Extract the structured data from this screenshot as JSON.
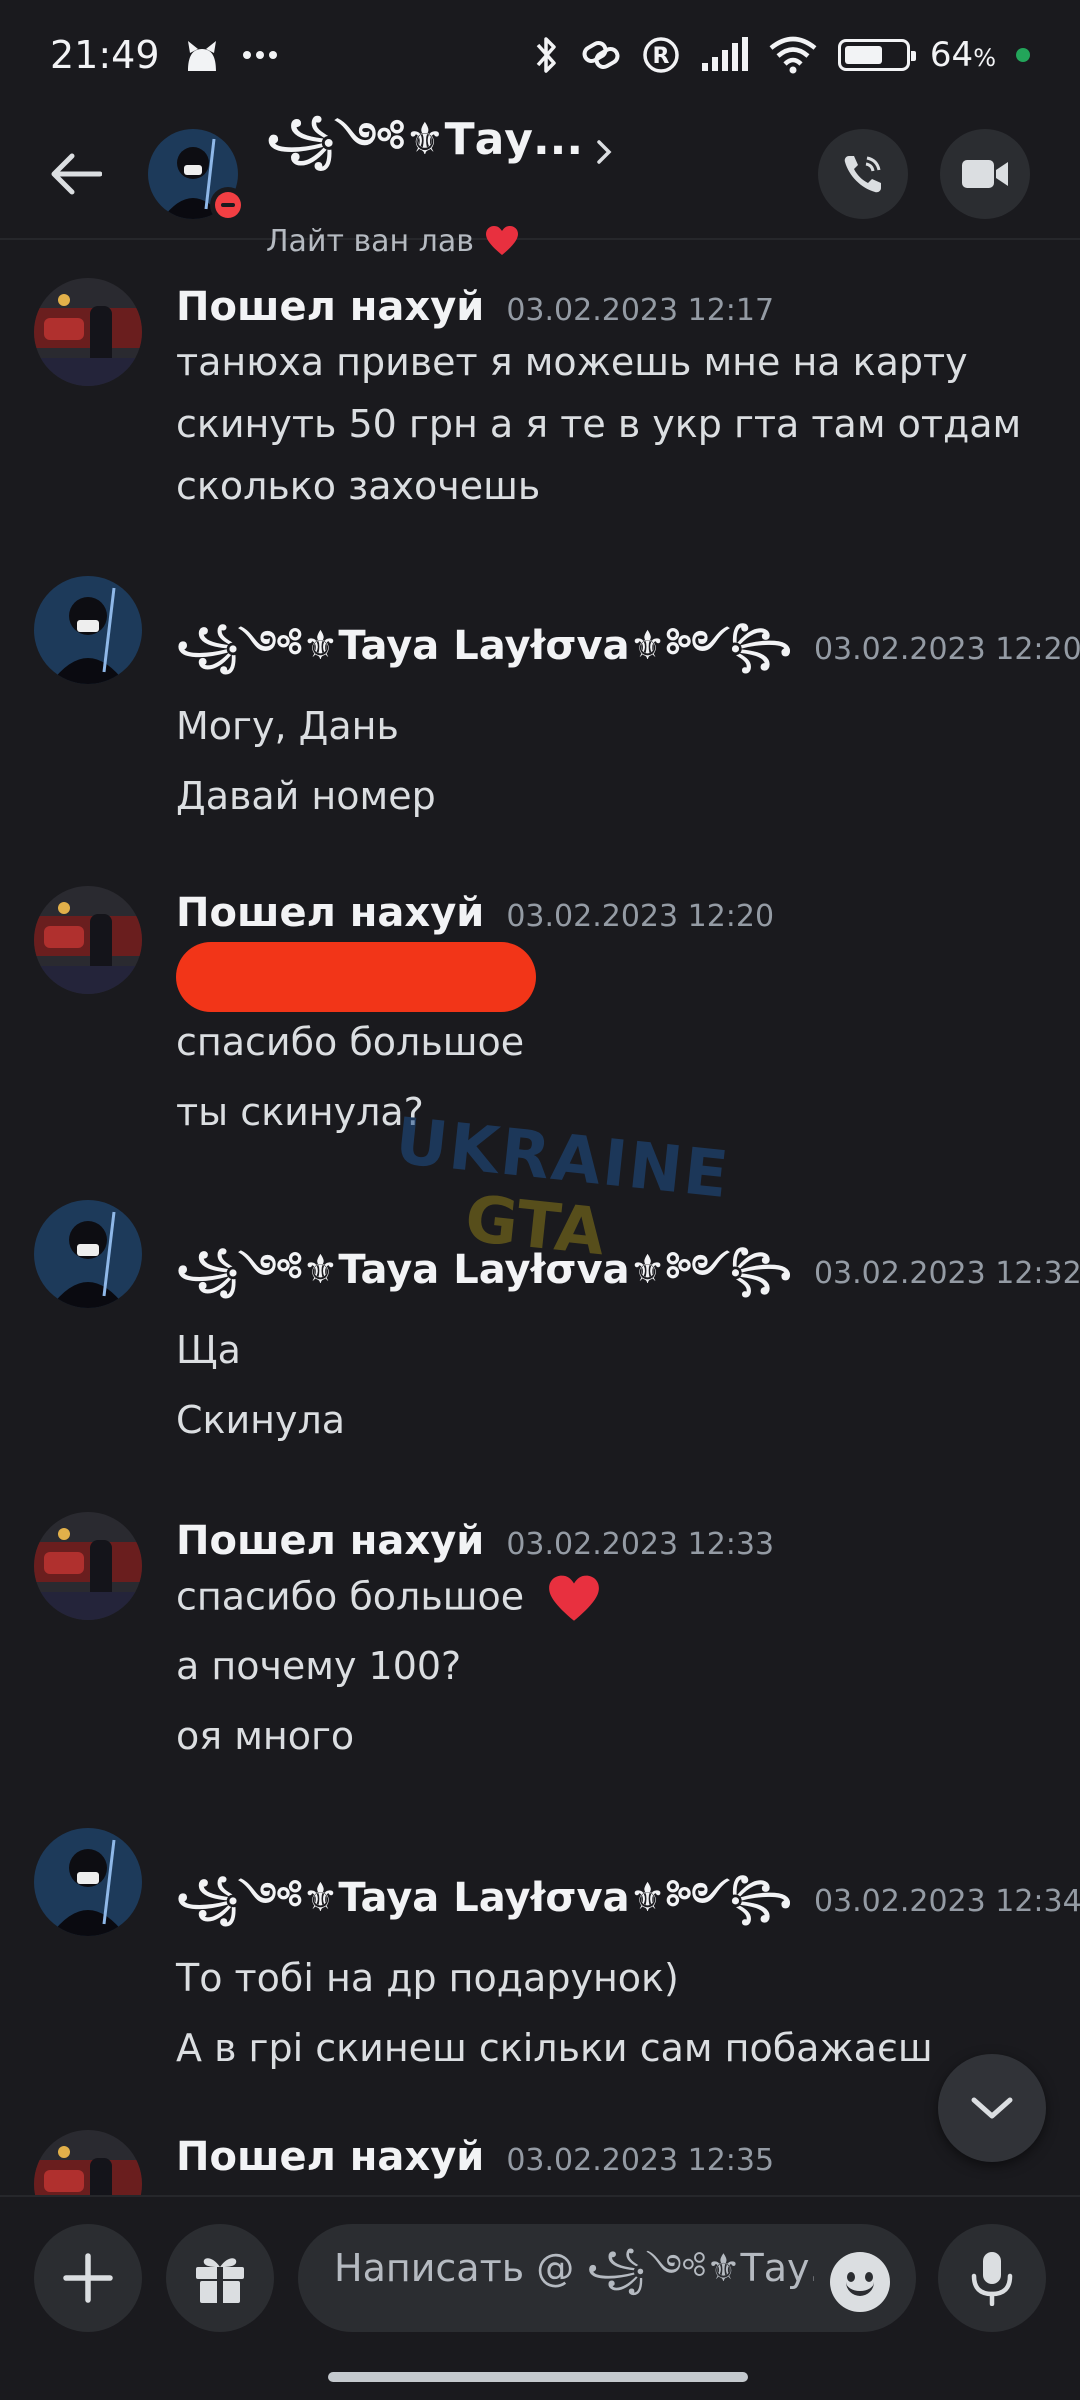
{
  "status_bar": {
    "time": "21:49",
    "battery_percent": "64",
    "battery_suffix": "%",
    "battery_level": 0.64,
    "icons": [
      "cat-icon",
      "more-dots-icon",
      "bluetooth-icon",
      "link-icon",
      "registered-icon",
      "signal-icon",
      "wifi-icon",
      "battery-icon"
    ]
  },
  "header": {
    "title": "꧁༺⚜Тау...",
    "subtitle": "Лайт ван лав",
    "status": "do-not-disturb",
    "icons": [
      "back-arrow-icon",
      "chevron-right-icon",
      "heart-icon",
      "phone-call-icon",
      "video-camera-icon"
    ]
  },
  "messages": [
    {
      "author": "Пошел нахуй",
      "timestamp": "03.02.2023 12:17",
      "lines": [
        "танюха привет я можешь мне на карту",
        "скинуть 50 грн а я те в укр гта там отдам",
        "сколько захочешь"
      ]
    },
    {
      "author": "꧁༺⚜Taya Layłσva⚜༻꧂",
      "timestamp": "03.02.2023 12:20",
      "lines": [
        "Могу, Дань",
        "Давай номер"
      ]
    },
    {
      "author": "Пошел нахуй",
      "timestamp": "03.02.2023 12:20",
      "redacted_line": true,
      "lines": [
        "спасибо большое",
        "ты скинула?"
      ]
    },
    {
      "author": "꧁༺⚜Taya Layłσva⚜༻꧂",
      "timestamp": "03.02.2023 12:32",
      "lines": [
        "Ща",
        "Скинула"
      ]
    },
    {
      "author": "Пошел нахуй",
      "timestamp": "03.02.2023 12:33",
      "lines": [
        "спасибо большое",
        "а почему 100?",
        "оя много"
      ]
    },
    {
      "author": "꧁༺⚜Taya Layłσva⚜༻꧂",
      "timestamp": "03.02.2023 12:34",
      "lines": [
        "То тобі на др подарунок)",
        "А в грі скинеш скільки сам побажаєш"
      ]
    },
    {
      "author": "Пошел нахуй",
      "timestamp": "03.02.2023 12:35",
      "lines": []
    }
  ],
  "watermark": {
    "line1": "UKRAINE",
    "line2": "GTA"
  },
  "composer": {
    "placeholder": "Написать @ ꧁༺⚜Тау...",
    "icons": [
      "plus-icon",
      "gift-icon",
      "emoji-icon",
      "microphone-icon"
    ]
  },
  "colors": {
    "background": "#1a1a1e",
    "dnd_red": "#f23f43",
    "redaction": "#f23518",
    "heart": "#e8303f"
  }
}
